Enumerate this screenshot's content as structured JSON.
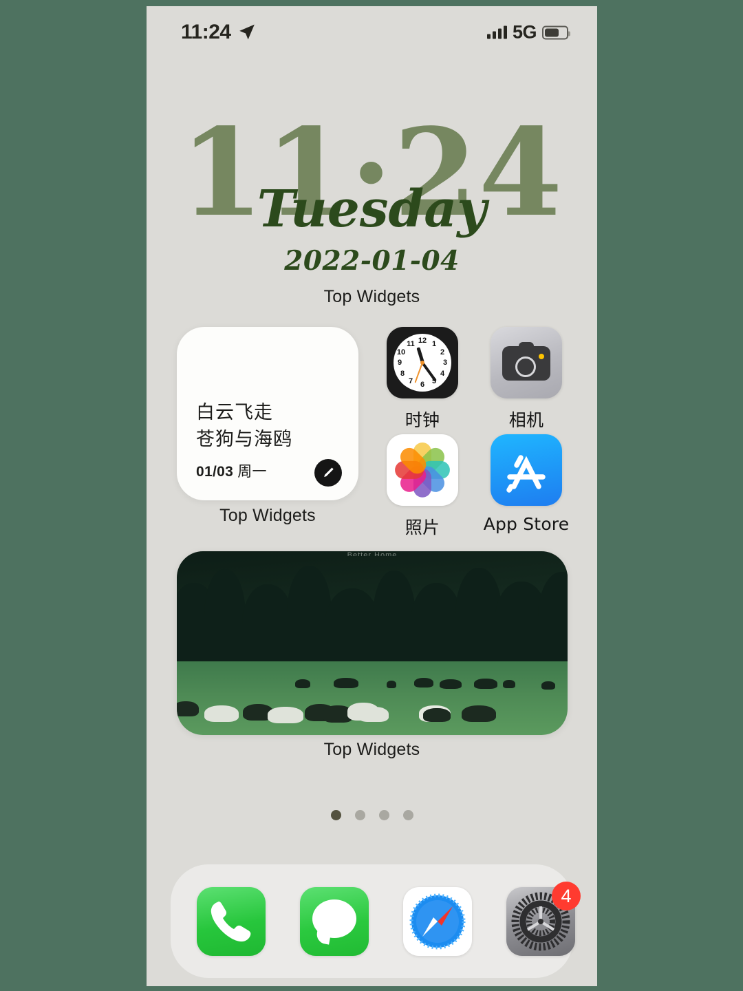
{
  "status_bar": {
    "time": "11:24",
    "location_icon": "location-arrow-icon",
    "signal_icon": "cellular-signal-icon",
    "network": "5G",
    "battery_icon": "battery-icon"
  },
  "clock_widget": {
    "time": "11·24",
    "weekday": "Tuesday",
    "date": "2022-01-04",
    "label": "Top Widgets",
    "time_color": "#768760",
    "text_color": "#2c4a1c"
  },
  "note_widget": {
    "line1": "白云飞走",
    "line2": "苍狗与海鸥",
    "date": "01/03",
    "weekday": "周一",
    "edit_icon": "pencil-edit-icon",
    "label": "Top Widgets"
  },
  "apps": [
    {
      "name": "时钟",
      "icon": "clock-icon"
    },
    {
      "name": "相机",
      "icon": "camera-icon"
    },
    {
      "name": "照片",
      "icon": "photos-icon"
    },
    {
      "name": "App Store",
      "icon": "app-store-icon"
    }
  ],
  "photo_widget": {
    "label": "Top Widgets",
    "watermark": "Better Home",
    "description": "sheep-and-yaks-grazing-meadow-photo"
  },
  "page_dots": {
    "count": 4,
    "active_index": 0
  },
  "dock": [
    {
      "name": "Phone",
      "icon": "phone-icon",
      "badge": ""
    },
    {
      "name": "Messages",
      "icon": "messages-icon",
      "badge": ""
    },
    {
      "name": "Safari",
      "icon": "safari-compass-icon",
      "badge": ""
    },
    {
      "name": "Settings",
      "icon": "settings-gear-icon",
      "badge": "4"
    }
  ],
  "colors": {
    "page_background": "#4e7260",
    "screen_background": "#dcdbd7",
    "badge": "#ff3b30"
  }
}
